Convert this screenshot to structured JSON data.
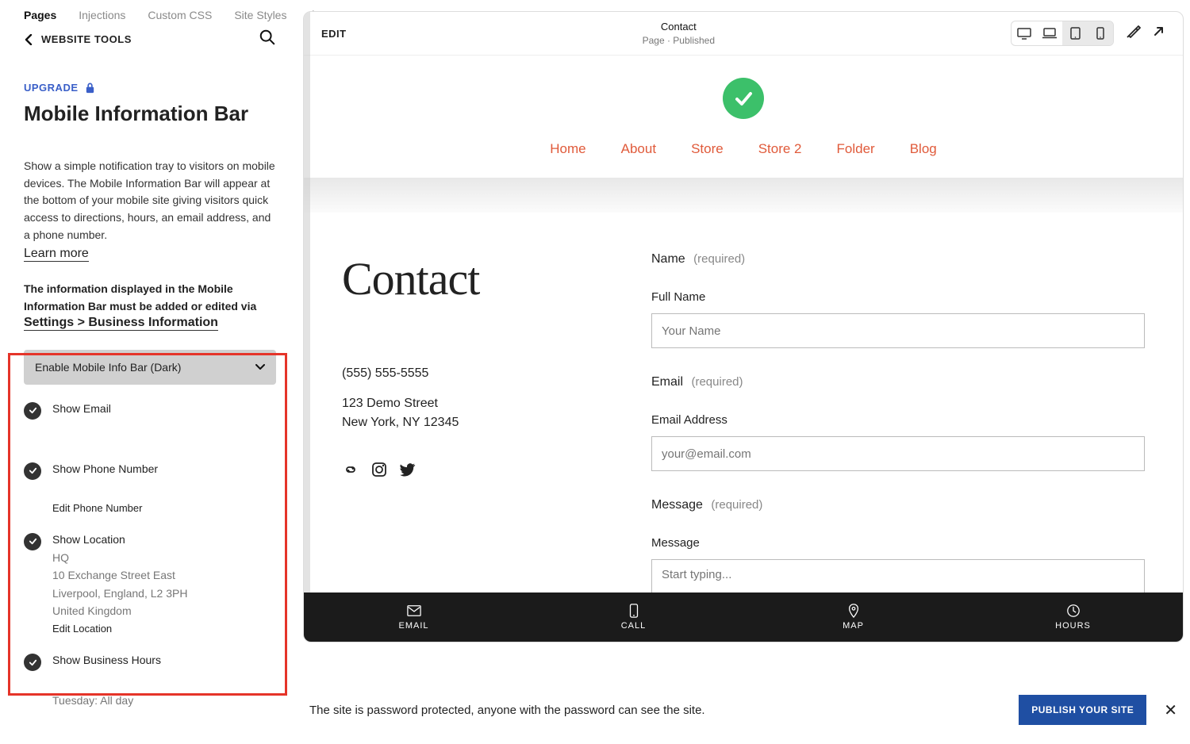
{
  "tabs": {
    "items": [
      "Pages",
      "Injections",
      "Custom CSS",
      "Site Styles"
    ],
    "active": 0
  },
  "sidebar": {
    "back_label": "WEBSITE TOOLS",
    "upgrade": "UPGRADE",
    "title": "Mobile Information Bar",
    "description": "Show a simple notification tray to visitors on mobile devices. The Mobile Information Bar will appear at the bottom of your mobile site giving visitors quick access to directions, hours, an email address, and a phone number.",
    "learn_more": "Learn more",
    "note": "The information displayed in the Mobile Information Bar must be added or edited via",
    "biz_link": "Settings > Business Information",
    "select": "Enable Mobile Info Bar (Dark)",
    "opts": {
      "email": {
        "label": "Show Email"
      },
      "phone": {
        "label": "Show Phone Number",
        "edit": "Edit Phone Number"
      },
      "location": {
        "label": "Show Location",
        "lines": [
          "HQ",
          "10 Exchange Street East",
          "Liverpool, England, L2 3PH",
          "United Kingdom"
        ],
        "edit": "Edit Location"
      },
      "hours": {
        "label": "Show Business Hours",
        "line": "Tuesday: All day"
      }
    }
  },
  "topbar": {
    "edit": "EDIT",
    "page_name": "Contact",
    "status": "Page · Published"
  },
  "nav": [
    "Home",
    "About",
    "Store",
    "Store 2",
    "Folder",
    "Blog"
  ],
  "page": {
    "heading": "Contact",
    "phone": "(555) 555-5555",
    "addr1": "123 Demo Street",
    "addr2": "New York, NY 12345",
    "form": {
      "name_label": "Name",
      "required": "(required)",
      "fullname": "Full Name",
      "name_ph": "Your Name",
      "email_label": "Email",
      "emailaddr": "Email Address",
      "email_ph": "your@email.com",
      "msg_label": "Message",
      "msg_sub": "Message",
      "msg_ph": "Start typing..."
    }
  },
  "mib": {
    "email": "EMAIL",
    "call": "CALL",
    "map": "MAP",
    "hours": "HOURS"
  },
  "publish": {
    "msg": "The site is password protected, anyone with the password can see the site.",
    "btn": "PUBLISH YOUR SITE"
  }
}
